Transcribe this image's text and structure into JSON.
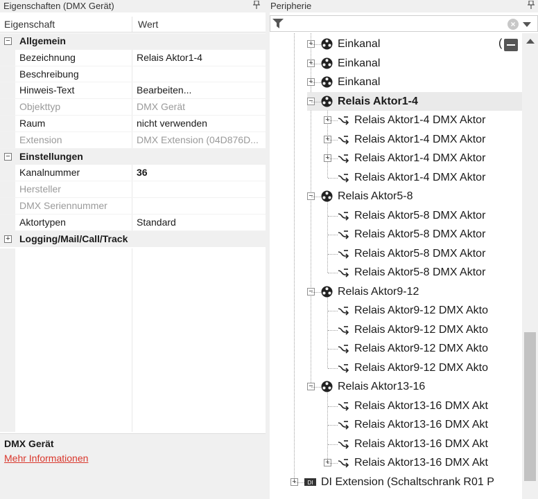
{
  "left_pane": {
    "title": "Eigenschaften (DMX Gerät)",
    "pin": "📌",
    "col_property": "Eigenschaft",
    "col_value": "Wert",
    "rows": [
      {
        "type": "cat",
        "name": "Allgemein",
        "toggle": "−"
      },
      {
        "type": "prop",
        "name": "Bezeichnung",
        "value": "Relais Aktor1-4"
      },
      {
        "type": "prop",
        "name": "Beschreibung",
        "value": ""
      },
      {
        "type": "prop",
        "name": "Hinweis-Text",
        "value": "Bearbeiten..."
      },
      {
        "type": "prop",
        "name": "Objekttyp",
        "value": "DMX Gerät",
        "disabled": true
      },
      {
        "type": "prop",
        "name": "Raum",
        "value": "nicht verwenden"
      },
      {
        "type": "prop",
        "name": "Extension",
        "value": "DMX Extension (04D876D...",
        "disabled": true
      },
      {
        "type": "cat",
        "name": "Einstellungen",
        "toggle": "−"
      },
      {
        "type": "prop",
        "name": "Kanalnummer",
        "value": "36",
        "bold": true
      },
      {
        "type": "prop",
        "name": "Hersteller",
        "value": "",
        "disabled": true
      },
      {
        "type": "prop",
        "name": "DMX Seriennummer",
        "value": "",
        "disabled": true
      },
      {
        "type": "prop",
        "name": "Aktortypen",
        "value": "Standard"
      },
      {
        "type": "cat",
        "name": "Logging/Mail/Call/Track",
        "toggle": "+"
      }
    ],
    "help_title": "DMX Gerät",
    "help_link": "Mehr Informationen"
  },
  "right_pane": {
    "title": "Peripherie",
    "pin": "📌",
    "filter_placeholder": "",
    "clear_glyph": "×",
    "tree": [
      {
        "level": 1,
        "label": "Einkanal",
        "icon": "dmx-device-icon",
        "exp": "+"
      },
      {
        "level": 1,
        "label": "Einkanal",
        "icon": "dmx-device-icon",
        "exp": "+"
      },
      {
        "level": 1,
        "label": "Einkanal",
        "icon": "dmx-device-icon",
        "exp": "+"
      },
      {
        "level": 1,
        "label": "Relais Aktor1-4",
        "icon": "dmx-device-icon",
        "exp": "−",
        "selected": true,
        "bold": true
      },
      {
        "level": 2,
        "label": "Relais Aktor1-4 DMX Aktor",
        "icon": "relay-switch-icon",
        "exp": "+"
      },
      {
        "level": 2,
        "label": "Relais Aktor1-4 DMX Aktor",
        "icon": "relay-switch-icon",
        "exp": "+"
      },
      {
        "level": 2,
        "label": "Relais Aktor1-4 DMX Aktor",
        "icon": "relay-switch-icon",
        "exp": "+"
      },
      {
        "level": 2,
        "label": "Relais Aktor1-4 DMX Aktor",
        "icon": "relay-switch-icon",
        "exp": ""
      },
      {
        "level": 1,
        "label": "Relais Aktor5-8",
        "icon": "dmx-device-icon",
        "exp": "−"
      },
      {
        "level": 2,
        "label": "Relais Aktor5-8 DMX Aktor",
        "icon": "relay-switch-icon",
        "exp": ""
      },
      {
        "level": 2,
        "label": "Relais Aktor5-8 DMX Aktor",
        "icon": "relay-switch-icon",
        "exp": ""
      },
      {
        "level": 2,
        "label": "Relais Aktor5-8 DMX Aktor",
        "icon": "relay-switch-icon",
        "exp": ""
      },
      {
        "level": 2,
        "label": "Relais Aktor5-8 DMX Aktor",
        "icon": "relay-switch-icon",
        "exp": ""
      },
      {
        "level": 1,
        "label": "Relais Aktor9-12",
        "icon": "dmx-device-icon",
        "exp": "−"
      },
      {
        "level": 2,
        "label": "Relais Aktor9-12 DMX Akto",
        "icon": "relay-switch-icon",
        "exp": ""
      },
      {
        "level": 2,
        "label": "Relais Aktor9-12 DMX Akto",
        "icon": "relay-switch-icon",
        "exp": ""
      },
      {
        "level": 2,
        "label": "Relais Aktor9-12 DMX Akto",
        "icon": "relay-switch-icon",
        "exp": ""
      },
      {
        "level": 2,
        "label": "Relais Aktor9-12 DMX Akto",
        "icon": "relay-switch-icon",
        "exp": ""
      },
      {
        "level": 1,
        "label": "Relais Aktor13-16",
        "icon": "dmx-device-icon",
        "exp": "−"
      },
      {
        "level": 2,
        "label": "Relais Aktor13-16 DMX Akt",
        "icon": "relay-switch-icon",
        "exp": ""
      },
      {
        "level": 2,
        "label": "Relais Aktor13-16 DMX Akt",
        "icon": "relay-switch-icon",
        "exp": ""
      },
      {
        "level": 2,
        "label": "Relais Aktor13-16 DMX Akt",
        "icon": "relay-switch-icon",
        "exp": ""
      },
      {
        "level": 2,
        "label": "Relais Aktor13-16 DMX Akt",
        "icon": "relay-switch-icon",
        "exp": "+"
      },
      {
        "level": 0,
        "label": "DI Extension (Schaltschrank R01 P",
        "icon": "di-extension-icon",
        "exp": "+",
        "badge": "DI"
      }
    ]
  },
  "colors": {
    "accent_link": "#d9362b",
    "selection": "#eaeaea",
    "pane_bg": "#f0f0f0"
  }
}
